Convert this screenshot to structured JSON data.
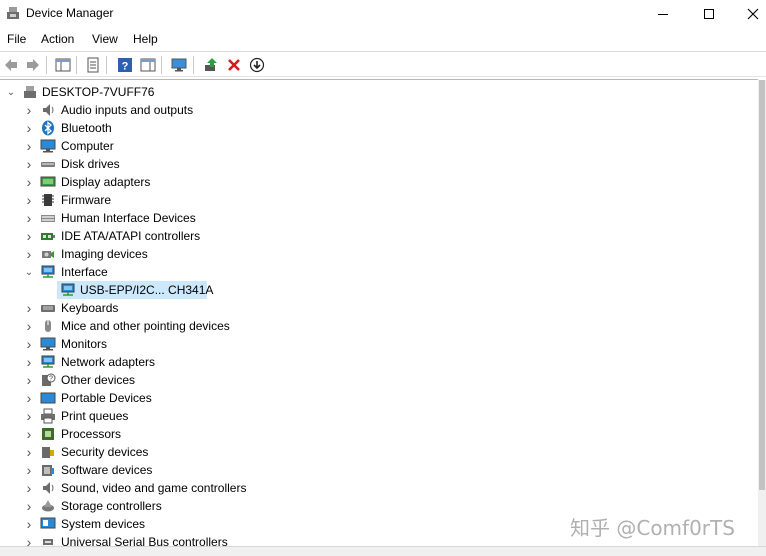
{
  "window": {
    "title": "Device Manager"
  },
  "menu": [
    "File",
    "Action",
    "View",
    "Help"
  ],
  "tree": {
    "root": "DESKTOP-7VUFF76",
    "categories": [
      {
        "label": "Audio inputs and outputs",
        "icon": "speaker-icon"
      },
      {
        "label": "Bluetooth",
        "icon": "bluetooth-icon"
      },
      {
        "label": "Computer",
        "icon": "computer-icon"
      },
      {
        "label": "Disk drives",
        "icon": "disk-drive-icon"
      },
      {
        "label": "Display adapters",
        "icon": "display-adapter-icon"
      },
      {
        "label": "Firmware",
        "icon": "chip-icon"
      },
      {
        "label": "Human Interface Devices",
        "icon": "hid-icon"
      },
      {
        "label": "IDE ATA/ATAPI controllers",
        "icon": "ide-controller-icon"
      },
      {
        "label": "Imaging devices",
        "icon": "camera-icon"
      },
      {
        "label": "Interface",
        "icon": "network-icon",
        "expanded": true,
        "children": [
          {
            "label": "USB-EPP/I2C... CH341A",
            "icon": "network-icon",
            "selected": true
          }
        ]
      },
      {
        "label": "Keyboards",
        "icon": "keyboard-icon"
      },
      {
        "label": "Mice and other pointing devices",
        "icon": "mouse-icon"
      },
      {
        "label": "Monitors",
        "icon": "monitor-icon"
      },
      {
        "label": "Network adapters",
        "icon": "network-icon"
      },
      {
        "label": "Other devices",
        "icon": "unknown-device-icon"
      },
      {
        "label": "Portable Devices",
        "icon": "portable-device-icon"
      },
      {
        "label": "Print queues",
        "icon": "printer-icon"
      },
      {
        "label": "Processors",
        "icon": "processor-icon"
      },
      {
        "label": "Security devices",
        "icon": "security-icon"
      },
      {
        "label": "Software devices",
        "icon": "software-icon"
      },
      {
        "label": "Sound, video and game controllers",
        "icon": "sound-icon"
      },
      {
        "label": "Storage controllers",
        "icon": "storage-icon"
      },
      {
        "label": "System devices",
        "icon": "system-icon"
      },
      {
        "label": "Universal Serial Bus controllers",
        "icon": "usb-icon"
      }
    ]
  },
  "watermark": "知乎 @Comf0rTS",
  "colors": {
    "selection": "#cce8ff",
    "accent": "#1e73be",
    "delete": "#d01c1c"
  }
}
